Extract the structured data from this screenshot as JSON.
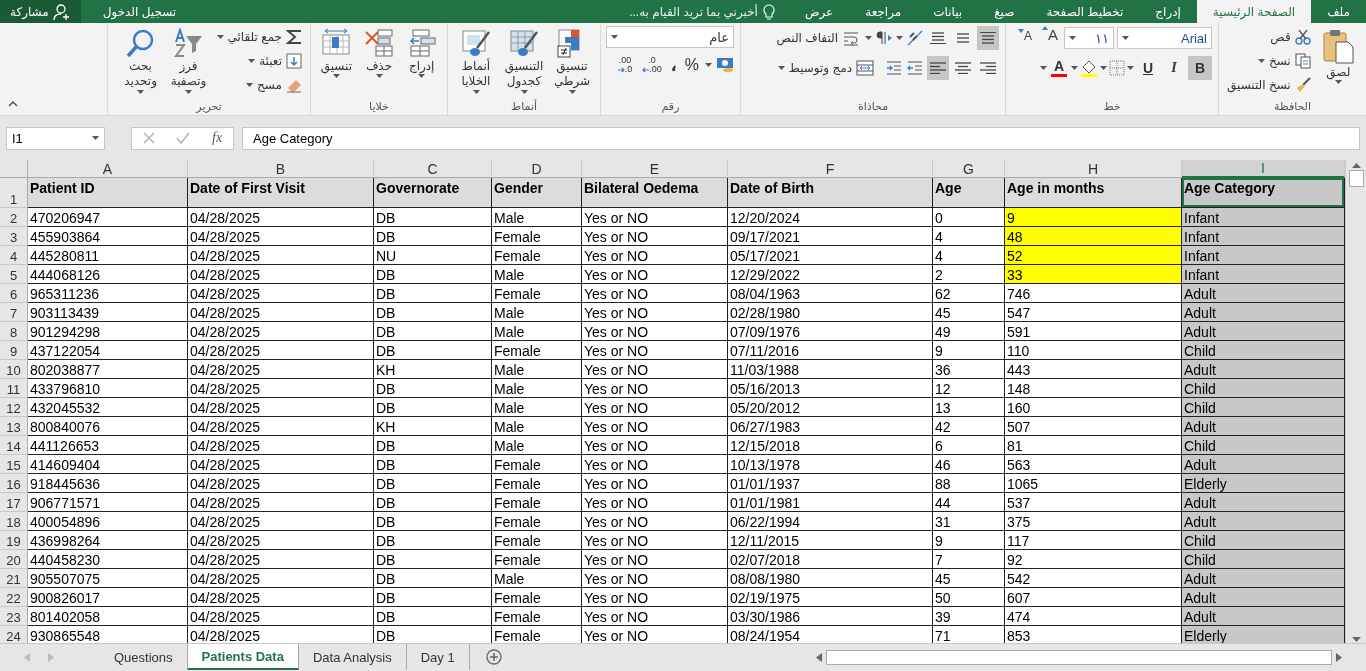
{
  "title_bar": {
    "share": "مشاركة",
    "sign_in": "تسجيل الدخول",
    "tell_me": "أخبرني بما تريد القيام به...",
    "tabs": [
      {
        "label": "ملف",
        "selected": false
      },
      {
        "label": "الصفحة الرئيسية",
        "selected": true
      },
      {
        "label": "إدراج",
        "selected": false
      },
      {
        "label": "تخطيط الصفحة",
        "selected": false
      },
      {
        "label": "صيغ",
        "selected": false
      },
      {
        "label": "بيانات",
        "selected": false
      },
      {
        "label": "مراجعة",
        "selected": false
      },
      {
        "label": "عرض",
        "selected": false
      }
    ]
  },
  "ribbon": {
    "clipboard": {
      "label": "الحافظة",
      "paste": "لصق",
      "cut": "قص",
      "copy": "نسخ",
      "format_painter": "نسخ التنسيق"
    },
    "font": {
      "label": "خط",
      "name": "Arial",
      "size": "١١",
      "grow": "A",
      "shrink": "A",
      "font_color": "A",
      "styles": [
        {
          "kind": "underline",
          "label": "U",
          "on": false
        },
        {
          "kind": "italic",
          "label": "I",
          "on": false
        },
        {
          "kind": "bold",
          "label": "B",
          "on": true
        }
      ]
    },
    "alignment": {
      "label": "محاذاة",
      "wrap_text": "التفاف النص",
      "merge_center": "دمج وتوسيط",
      "vertical": [
        {
          "kind": "top",
          "on": true
        },
        {
          "kind": "middle",
          "on": false
        },
        {
          "kind": "bottom",
          "on": false
        }
      ],
      "horizontal": [
        {
          "kind": "right",
          "on": false
        },
        {
          "kind": "center",
          "on": false
        },
        {
          "kind": "left",
          "on": true
        }
      ]
    },
    "number": {
      "label": "رقم",
      "format": "عام",
      "percent": "%",
      "comma": "،",
      "decimals": [
        {
          "kind": "decrease",
          "upper": ".00",
          "lower": ".0"
        },
        {
          "kind": "increase",
          "upper": ".0",
          "lower": ".00"
        }
      ]
    },
    "styles": {
      "label": "أنماط",
      "buttons": [
        {
          "kind": "conditional",
          "lines": [
            "تنسيق",
            "شرطي"
          ]
        },
        {
          "kind": "table",
          "lines": [
            "التنسيق",
            "كجدول"
          ]
        },
        {
          "kind": "cell",
          "lines": [
            "أنماط",
            "الخلايا"
          ]
        }
      ]
    },
    "cells": {
      "label": "خلايا",
      "buttons": [
        {
          "kind": "insert",
          "label": "إدراج"
        },
        {
          "kind": "delete",
          "label": "حذف"
        },
        {
          "kind": "format",
          "label": "تنسيق"
        }
      ]
    },
    "editing": {
      "label": "تحرير",
      "autosum": "جمع تلقائي",
      "fill": "تعبئة",
      "clear": "مسح",
      "sort": [
        "فرز",
        "وتصفية"
      ],
      "find": [
        "بحث",
        "وتحديد"
      ]
    }
  },
  "formula_bar": {
    "name_box": "I1",
    "fx": "fx",
    "formula": "Age Category"
  },
  "sheet": {
    "columns": [
      {
        "letter": "A",
        "header": "Patient ID",
        "selected": false
      },
      {
        "letter": "B",
        "header": "Date of First Visit",
        "selected": false
      },
      {
        "letter": "C",
        "header": "Governorate",
        "selected": false
      },
      {
        "letter": "D",
        "header": "Gender",
        "selected": false
      },
      {
        "letter": "E",
        "header": "Bilateral Oedema",
        "selected": false
      },
      {
        "letter": "F",
        "header": "Date of Birth",
        "selected": false
      },
      {
        "letter": "G",
        "header": "Age",
        "selected": false
      },
      {
        "letter": "H",
        "header": "Age in months",
        "selected": false
      },
      {
        "letter": "I",
        "header": "Age Category",
        "selected": true
      }
    ],
    "header_row_number": "1",
    "rows": [
      {
        "number": "2",
        "highlighted": true,
        "cells": [
          "470206947",
          "04/28/2025",
          "DB",
          "Male",
          "Yes or NO",
          "12/20/2024",
          "0",
          "9",
          "Infant"
        ]
      },
      {
        "number": "3",
        "highlighted": true,
        "cells": [
          "455903864",
          "04/28/2025",
          "DB",
          "Female",
          "Yes or NO",
          "09/17/2021",
          "4",
          "48",
          "Infant"
        ]
      },
      {
        "number": "4",
        "highlighted": true,
        "cells": [
          "445280811",
          "04/28/2025",
          "NU",
          "Female",
          "Yes or NO",
          "05/17/2021",
          "4",
          "52",
          "Infant"
        ]
      },
      {
        "number": "5",
        "highlighted": true,
        "cells": [
          "444068126",
          "04/28/2025",
          "DB",
          "Male",
          "Yes or NO",
          "12/29/2022",
          "2",
          "33",
          "Infant"
        ]
      },
      {
        "number": "6",
        "highlighted": false,
        "cells": [
          "965311236",
          "04/28/2025",
          "DB",
          "Female",
          "Yes or NO",
          "08/04/1963",
          "62",
          "746",
          "Adult"
        ]
      },
      {
        "number": "7",
        "highlighted": false,
        "cells": [
          "903113439",
          "04/28/2025",
          "DB",
          "Male",
          "Yes or NO",
          "02/28/1980",
          "45",
          "547",
          "Adult"
        ]
      },
      {
        "number": "8",
        "highlighted": false,
        "cells": [
          "901294298",
          "04/28/2025",
          "DB",
          "Male",
          "Yes or NO",
          "07/09/1976",
          "49",
          "591",
          "Adult"
        ]
      },
      {
        "number": "9",
        "highlighted": false,
        "cells": [
          "437122054",
          "04/28/2025",
          "DB",
          "Female",
          "Yes or NO",
          "07/11/2016",
          "9",
          "110",
          "Child"
        ]
      },
      {
        "number": "10",
        "highlighted": false,
        "cells": [
          "802038877",
          "04/28/2025",
          "KH",
          "Male",
          "Yes or NO",
          "11/03/1988",
          "36",
          "443",
          "Adult"
        ]
      },
      {
        "number": "11",
        "highlighted": false,
        "cells": [
          "433796810",
          "04/28/2025",
          "DB",
          "Male",
          "Yes or NO",
          "05/16/2013",
          "12",
          "148",
          "Child"
        ]
      },
      {
        "number": "12",
        "highlighted": false,
        "cells": [
          "432045532",
          "04/28/2025",
          "DB",
          "Male",
          "Yes or NO",
          "05/20/2012",
          "13",
          "160",
          "Child"
        ]
      },
      {
        "number": "13",
        "highlighted": false,
        "cells": [
          "800840076",
          "04/28/2025",
          "KH",
          "Male",
          "Yes or NO",
          "06/27/1983",
          "42",
          "507",
          "Adult"
        ]
      },
      {
        "number": "14",
        "highlighted": false,
        "cells": [
          "441126653",
          "04/28/2025",
          "DB",
          "Male",
          "Yes or NO",
          "12/15/2018",
          "6",
          "81",
          "Child"
        ]
      },
      {
        "number": "15",
        "highlighted": false,
        "cells": [
          "414609404",
          "04/28/2025",
          "DB",
          "Female",
          "Yes or NO",
          "10/13/1978",
          "46",
          "563",
          "Adult"
        ]
      },
      {
        "number": "16",
        "highlighted": false,
        "cells": [
          "918445636",
          "04/28/2025",
          "DB",
          "Female",
          "Yes or NO",
          "01/01/1937",
          "88",
          "1065",
          "Elderly"
        ]
      },
      {
        "number": "17",
        "highlighted": false,
        "cells": [
          "906771571",
          "04/28/2025",
          "DB",
          "Female",
          "Yes or NO",
          "01/01/1981",
          "44",
          "537",
          "Adult"
        ]
      },
      {
        "number": "18",
        "highlighted": false,
        "cells": [
          "400054896",
          "04/28/2025",
          "DB",
          "Female",
          "Yes or NO",
          "06/22/1994",
          "31",
          "375",
          "Adult"
        ]
      },
      {
        "number": "19",
        "highlighted": false,
        "cells": [
          "436998264",
          "04/28/2025",
          "DB",
          "Female",
          "Yes or NO",
          "12/11/2015",
          "9",
          "117",
          "Child"
        ]
      },
      {
        "number": "20",
        "highlighted": false,
        "cells": [
          "440458230",
          "04/28/2025",
          "DB",
          "Female",
          "Yes or NO",
          "02/07/2018",
          "7",
          "92",
          "Child"
        ]
      },
      {
        "number": "21",
        "highlighted": false,
        "cells": [
          "905507075",
          "04/28/2025",
          "DB",
          "Male",
          "Yes or NO",
          "08/08/1980",
          "45",
          "542",
          "Adult"
        ]
      },
      {
        "number": "22",
        "highlighted": false,
        "cells": [
          "900826017",
          "04/28/2025",
          "DB",
          "Female",
          "Yes or NO",
          "02/19/1975",
          "50",
          "607",
          "Adult"
        ]
      },
      {
        "number": "23",
        "highlighted": false,
        "cells": [
          "801402058",
          "04/28/2025",
          "DB",
          "Female",
          "Yes or NO",
          "03/30/1986",
          "39",
          "474",
          "Adult"
        ]
      },
      {
        "number": "24",
        "highlighted": false,
        "cells": [
          "930865548",
          "04/28/2025",
          "DB",
          "Female",
          "Yes or NO",
          "08/24/1954",
          "71",
          "853",
          "Elderly"
        ]
      }
    ]
  },
  "sheet_tabs": [
    {
      "label": "Questions",
      "selected": false
    },
    {
      "label": "Patients Data",
      "selected": true
    },
    {
      "label": "Data Analysis",
      "selected": false
    },
    {
      "label": "Day 1",
      "selected": false
    }
  ]
}
